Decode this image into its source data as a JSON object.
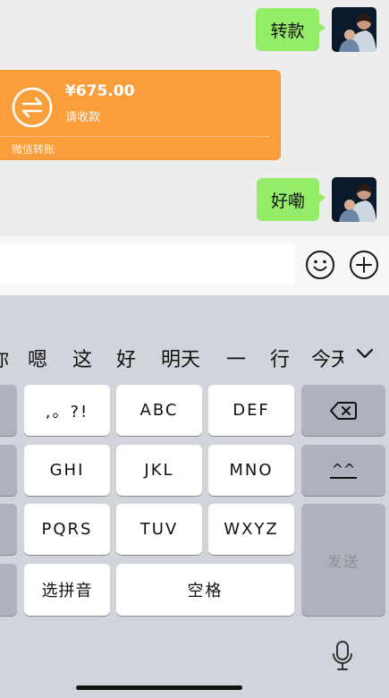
{
  "chat": {
    "messages": [
      {
        "text": "转款"
      },
      {
        "text": "好嘞"
      }
    ],
    "transfer": {
      "amount": "¥675.00",
      "status": "请收款",
      "footer": "微信转账"
    }
  },
  "input": {
    "placeholder": "",
    "value": ""
  },
  "keyboard": {
    "candidates": [
      "你",
      "嗯",
      "这",
      "好",
      "明天",
      "一",
      "行",
      "今天"
    ],
    "keys": {
      "punct": ",。?!",
      "abc": "ABC",
      "def": "DEF",
      "ghi": "GHI",
      "jkl": "JKL",
      "mno": "MNO",
      "pqrs": "PQRS",
      "tuv": "TUV",
      "wxyz": "WXYZ",
      "pinyin": "选拼音",
      "space": "空格",
      "send": "发送",
      "caret": "^^"
    }
  },
  "colors": {
    "bubble_green": "#95ec69",
    "transfer_orange": "#fa9d3b",
    "keyboard_bg": "#d1d4db"
  }
}
